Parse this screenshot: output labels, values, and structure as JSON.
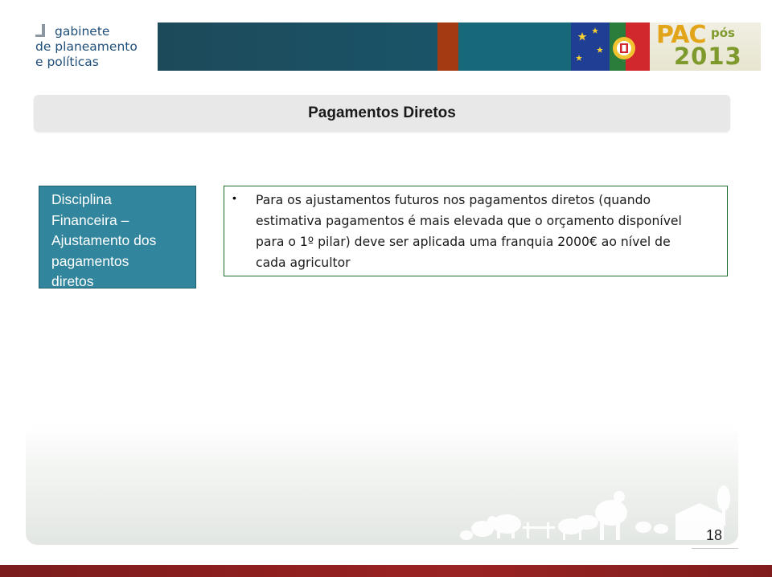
{
  "logo": {
    "line1": "gabinete",
    "line2": "de planeamento",
    "line3": "e políticas"
  },
  "header": {
    "pac_label": "PAC",
    "pos_label": "pós",
    "year_label": "2013"
  },
  "title": "Pagamentos Diretos",
  "discipline_box": {
    "lines": [
      "Disciplina",
      "Financeira –",
      "Ajustamento dos",
      "pagamentos",
      "diretos"
    ]
  },
  "content_box": {
    "bullet": "•",
    "lines": [
      "Para os ajustamentos futuros nos pagamentos diretos (quando",
      "estimativa pagamentos é mais elevada que o orçamento disponível",
      "para o 1º pilar) deve ser aplicada uma franquia 2000€ ao nível de",
      "cada agricultor"
    ]
  },
  "page_number": "18",
  "colors": {
    "teal_box": "#31859c",
    "content_border": "#1e6b2a",
    "footer": "#8f1f1f",
    "header": "#1a5266",
    "accent_rust": "#a33a12"
  }
}
